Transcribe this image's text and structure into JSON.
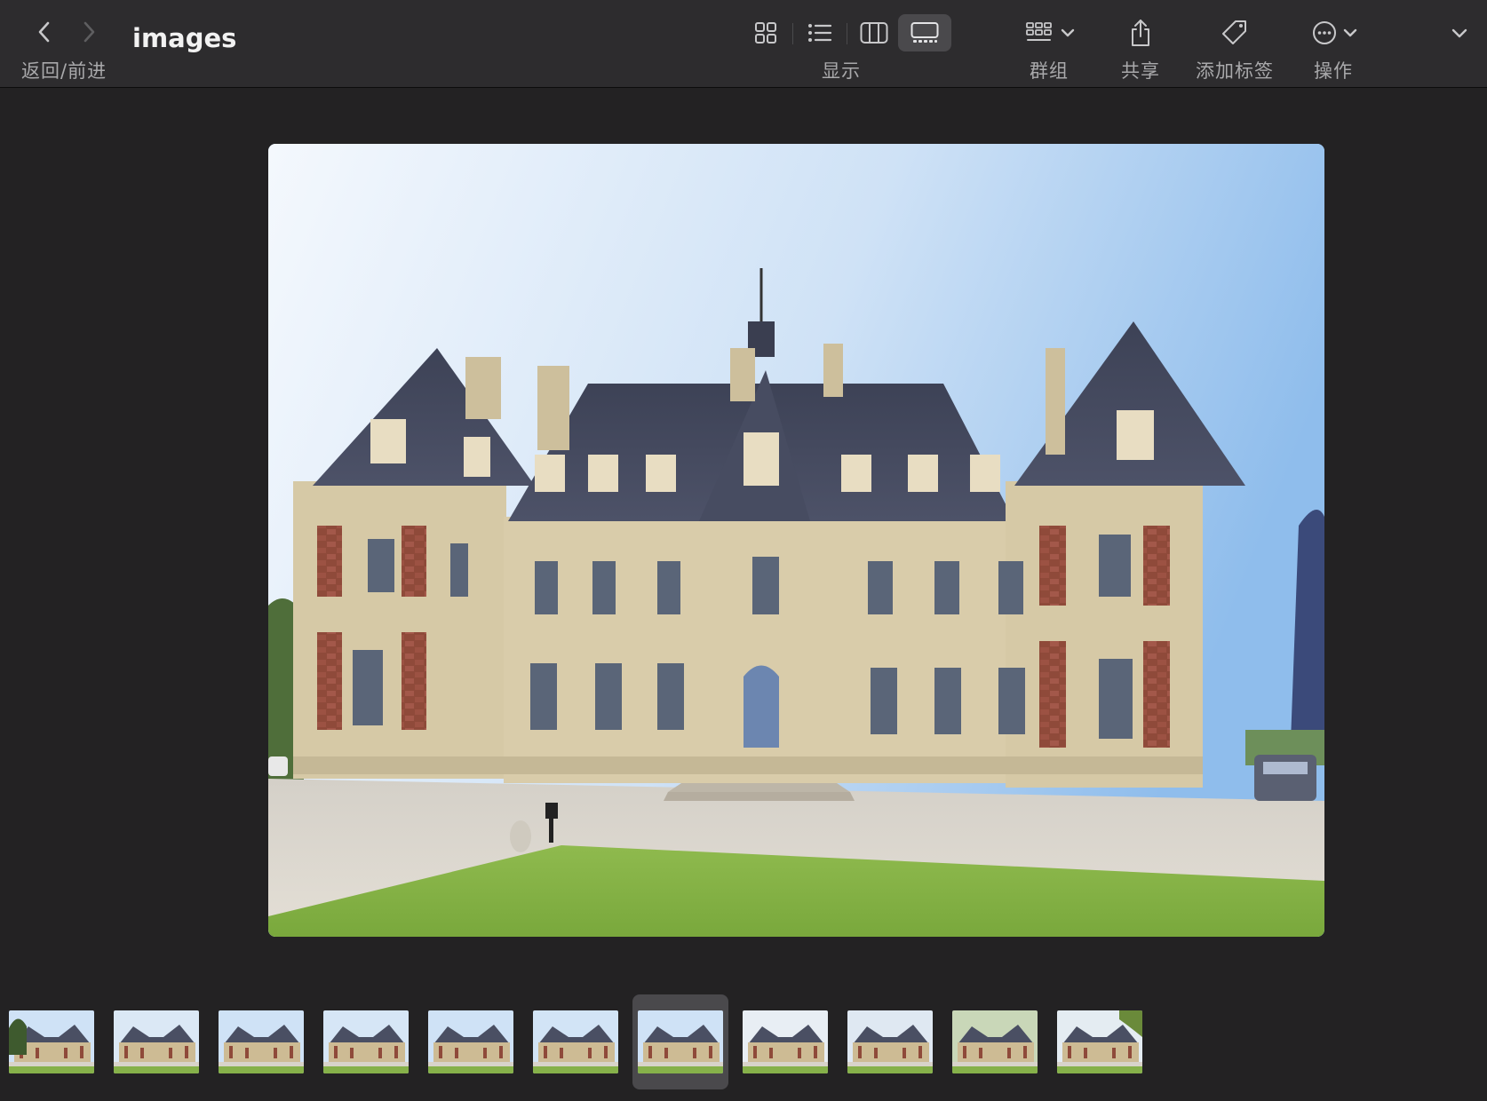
{
  "toolbar": {
    "nav_label": "返回/前进",
    "title": "images",
    "display_label": "显示",
    "group_label": "群组",
    "share_label": "共享",
    "tag_label": "添加标签",
    "action_label": "操作"
  },
  "icons": {
    "back": "chevron-left-icon",
    "forward": "chevron-right-icon",
    "grid_view": "icon-view-icon",
    "list_view": "list-view-icon",
    "column_view": "column-view-icon",
    "gallery_view": "gallery-view-icon",
    "group": "group-icon",
    "share": "share-icon",
    "tag": "tag-icon",
    "more": "ellipsis-circle-icon",
    "overflow": "chevron-down-icon"
  },
  "colors": {
    "window_bg": "#232223",
    "toolbar_bg": "#2d2c2e",
    "selection_bg": "#4a494c",
    "icon": "#c8c8ca",
    "icon_dim": "#5e5e60"
  },
  "gallery": {
    "view_mode": "gallery",
    "thumbnail_count": 11,
    "selected_index": 6
  }
}
